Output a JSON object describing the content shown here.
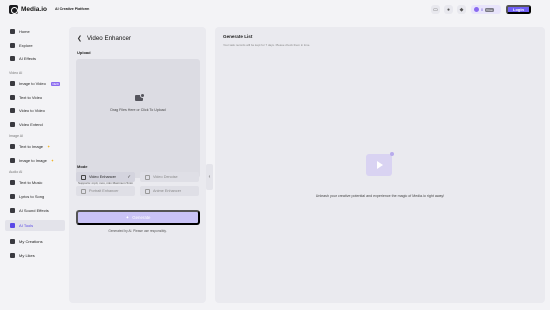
{
  "app": {
    "logo_text": "Media.io",
    "platform": "AI Creative Platform"
  },
  "topbar": {
    "credits": "0",
    "credits_badge": "Free",
    "login_label": "Login",
    "icons": [
      "message-icon",
      "bell-icon",
      "gift-icon"
    ]
  },
  "sidebar": {
    "items": [
      {
        "label": "Home",
        "icon": "home-icon"
      },
      {
        "label": "Explore",
        "icon": "compass-icon"
      },
      {
        "label": "AI Effects",
        "icon": "sparkle-icon"
      },
      {
        "label": "Image to Video",
        "icon": "image-video-icon",
        "badge": "NEW"
      },
      {
        "label": "Text to Video",
        "icon": "text-video-icon"
      },
      {
        "label": "Video to Video",
        "icon": "video-video-icon"
      },
      {
        "label": "Video Extend",
        "icon": "extend-icon"
      },
      {
        "label": "Text to Image",
        "icon": "text-image-icon"
      },
      {
        "label": "Image to Image",
        "icon": "image-image-icon"
      },
      {
        "label": "Text to Music",
        "icon": "music-icon"
      },
      {
        "label": "Lyrics to Song",
        "icon": "lyrics-icon"
      },
      {
        "label": "AI Sound Effects",
        "icon": "sound-icon"
      },
      {
        "label": "AI Tools",
        "icon": "tools-icon"
      },
      {
        "label": "My Creations",
        "icon": "folder-icon"
      },
      {
        "label": "My Likes",
        "icon": "heart-icon"
      }
    ],
    "sections": {
      "video": "Video AI",
      "image": "Image AI",
      "audio": "Audio AI"
    }
  },
  "tool_panel": {
    "title": "Video Enhancer",
    "upload_label": "Upload",
    "upload_text": "Drag Files Here or Click To Upload",
    "support_text": "Supports: mp4, mov, mkv Maximum 5min",
    "mode_label": "Mode",
    "modes": [
      "Video Enhancer",
      "Video Denoise",
      "Portrait Enhancer",
      "Anime Enhancer"
    ],
    "selected_mode": "Video Enhancer",
    "generate_label": "Generate",
    "disclaimer": "Generated by AI. Please use responsibly."
  },
  "generate_list": {
    "title": "Generate List",
    "subtitle": "Your task records will be kept for 7 days. Please check them in time.",
    "empty_text": "Unleash your creative potential and experience the magic of Media.io right away!"
  },
  "colors": {
    "accent": "#6f5ef5",
    "active_text": "#5a49e6",
    "generate_disabled": "#c9c3f6"
  }
}
